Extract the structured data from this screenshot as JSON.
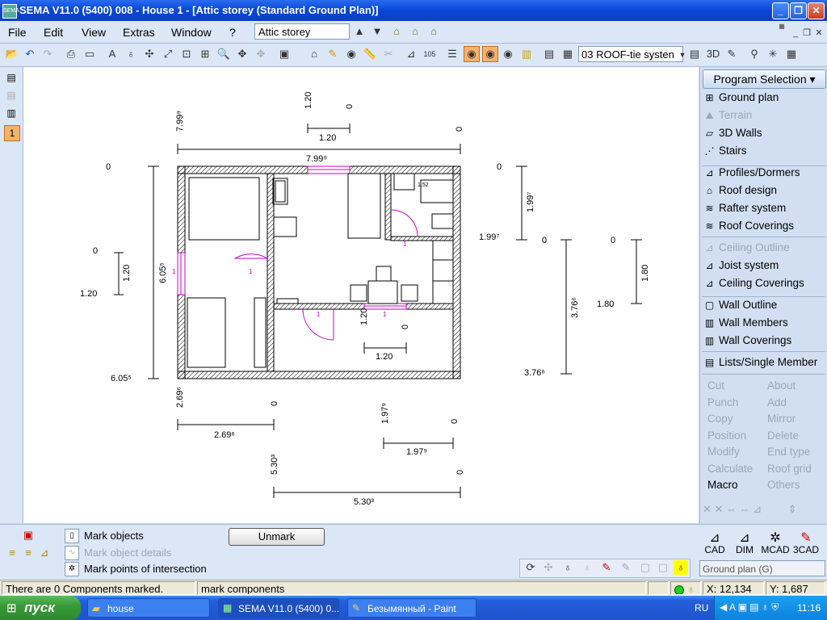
{
  "window": {
    "title": "SEMA V11.0 (5400) 008 - House 1  - [Attic storey (Standard Ground Plan)]",
    "app_icon_label": "SEMA"
  },
  "menu": {
    "items": [
      "File",
      "Edit",
      "View",
      "Extras",
      "Window",
      "?"
    ],
    "storey_value": "Attic storey"
  },
  "toolbar": {
    "roof_select_value": "03 ROOF-tie systen",
    "number_label": "105"
  },
  "left_strip": {
    "active_label": "1"
  },
  "drawing": {
    "top_dim": "7.99⁹",
    "inner_top_dim": "7.99⁹",
    "window_dim_a": "1.20",
    "window_dim_zero_a": "0",
    "window_dim_b": "1.20",
    "top_zero": "0",
    "left_zero": "0",
    "left_total": "6.05⁵",
    "left_total_end": "6.05⁵",
    "left_win_zero": "0",
    "left_win_dim": "1.20",
    "left_win_end": "1.20",
    "right_a_zero": "0",
    "right_a_dim": "1.99⁷",
    "right_a_end": "1.99⁷",
    "right_b_zero": "0",
    "right_b_dim": "3.76⁶",
    "right_b_end": "3.76⁶",
    "right_c_zero": "0",
    "right_c_dim": "1.80",
    "right_c_end": "1.80",
    "bottom_win_vert": "1.20",
    "bottom_win_zero": "0",
    "bottom_win_dim": "1.20",
    "b1_start": "2.69⁶",
    "b1_zero": "0",
    "b1_dim": "2.69⁶",
    "b2_start": "1.97⁹",
    "b2_zero": "0",
    "b2_dim": "1.97⁹",
    "b3_start": "5.30³",
    "b3_zero": "0",
    "b3_dim": "5.30³",
    "door_label": "1",
    "small_label": "1.52"
  },
  "program": {
    "selector_label": "Program Selection",
    "items": [
      {
        "label": "Ground plan",
        "icon": "ground-plan-icon",
        "enabled": true
      },
      {
        "label": "Terrain",
        "icon": "terrain-icon",
        "enabled": false
      },
      {
        "label": "3D Walls",
        "icon": "3d-walls-icon",
        "enabled": true
      },
      {
        "label": "Stairs",
        "icon": "stairs-icon",
        "enabled": true
      },
      {
        "label": "Profiles/Dormers",
        "icon": "profiles-icon",
        "enabled": true
      },
      {
        "label": "Roof design",
        "icon": "roof-design-icon",
        "enabled": true
      },
      {
        "label": "Rafter system",
        "icon": "rafter-icon",
        "enabled": true
      },
      {
        "label": "Roof Coverings",
        "icon": "roof-coverings-icon",
        "enabled": true
      },
      {
        "label": "Ceiling Outline",
        "icon": "ceiling-outline-icon",
        "enabled": false
      },
      {
        "label": "Joist system",
        "icon": "joist-icon",
        "enabled": true
      },
      {
        "label": "Ceiling Coverings",
        "icon": "ceiling-coverings-icon",
        "enabled": true
      },
      {
        "label": "Wall Outline",
        "icon": "wall-outline-icon",
        "enabled": true
      },
      {
        "label": "Wall Members",
        "icon": "wall-members-icon",
        "enabled": true
      },
      {
        "label": "Wall Coverings",
        "icon": "wall-coverings-icon",
        "enabled": true
      },
      {
        "label": "Lists/Single Member",
        "icon": "lists-icon",
        "enabled": true
      }
    ],
    "commands_left": [
      "Cut",
      "Punch",
      "Copy",
      "Position",
      "Modify",
      "Calculate",
      "Macro"
    ],
    "commands_right": [
      "About",
      "Add",
      "Mirror",
      "Delete",
      "End type",
      "Roof grid",
      "Others"
    ]
  },
  "bottom": {
    "options": [
      {
        "label": "Mark objects",
        "enabled": true
      },
      {
        "label": "Mark object details",
        "enabled": false
      },
      {
        "label": "Mark points of intersection",
        "enabled": true
      }
    ],
    "unmark_label": "Unmark",
    "modes": [
      "CAD",
      "DIM",
      "MCAD",
      "3CAD"
    ],
    "ground_select_value": "Ground plan  (G)"
  },
  "status": {
    "components": "There are  0 Components marked.",
    "action": "mark components",
    "x": "X: 12,134",
    "y": "Y:  1,687"
  },
  "taskbar": {
    "start_label": "пуск",
    "tasks": [
      "house",
      "SEMA V11.0 (5400) 0...",
      "Безымянный - Paint"
    ],
    "lang": "RU",
    "time": "11:16"
  },
  "colors": {
    "accent": "#0a48d8",
    "door": "#cc00cc",
    "highlight": "#f6b26b"
  }
}
